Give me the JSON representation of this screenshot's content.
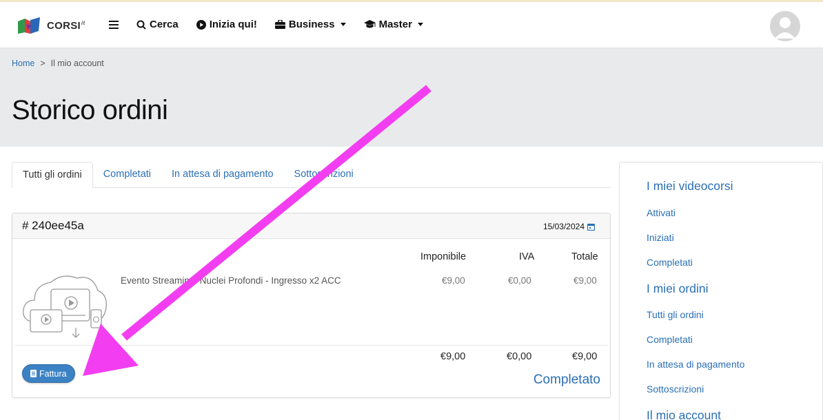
{
  "brand": {
    "name": "CORSI",
    "suffix": "it"
  },
  "nav": {
    "menu_icon": "hamburger-icon",
    "items": [
      {
        "label": "Cerca",
        "icon": "search-icon"
      },
      {
        "label": "Inizia qui!",
        "icon": "play-circle-icon"
      },
      {
        "label": "Business",
        "icon": "briefcase-icon",
        "dropdown": true
      },
      {
        "label": "Master",
        "icon": "graduation-cap-icon",
        "dropdown": true
      }
    ]
  },
  "breadcrumb": {
    "home": "Home",
    "separator": ">",
    "current": "Il mio account"
  },
  "page": {
    "title": "Storico ordini"
  },
  "tabs": [
    {
      "label": "Tutti gli ordini",
      "active": true
    },
    {
      "label": "Completati",
      "active": false
    },
    {
      "label": "In attesa di pagamento",
      "active": false
    },
    {
      "label": "Sottoscrizioni",
      "active": false
    }
  ],
  "order": {
    "id": "# 240ee45a",
    "date": "15/03/2024",
    "columns": {
      "imponibile": "Imponibile",
      "iva": "IVA",
      "totale": "Totale"
    },
    "items": [
      {
        "name": "Evento Streaming: Nuclei Profondi - Ingresso x2 ACC",
        "imponibile": "€9,00",
        "iva": "€0,00",
        "totale": "€9,00"
      }
    ],
    "totals": {
      "imponibile": "€9,00",
      "iva": "€0,00",
      "totale": "€9,00"
    },
    "invoice_button": "Fattura",
    "status": "Completato"
  },
  "sidebar": {
    "sections": [
      {
        "heading": "I miei videocorsi",
        "links": [
          "Attivati",
          "Iniziati",
          "Completati"
        ]
      },
      {
        "heading": "I miei ordini",
        "links": [
          "Tutti gli ordini",
          "Completati",
          "In attesa di pagamento",
          "Sottoscrizioni"
        ]
      },
      {
        "heading": "Il mio account",
        "links": []
      }
    ]
  },
  "colors": {
    "link": "#2a6fb5",
    "header_band": "#e9eaeb",
    "invoice_button": "#3b82c4",
    "annotation_arrow": "#f23ef0"
  }
}
